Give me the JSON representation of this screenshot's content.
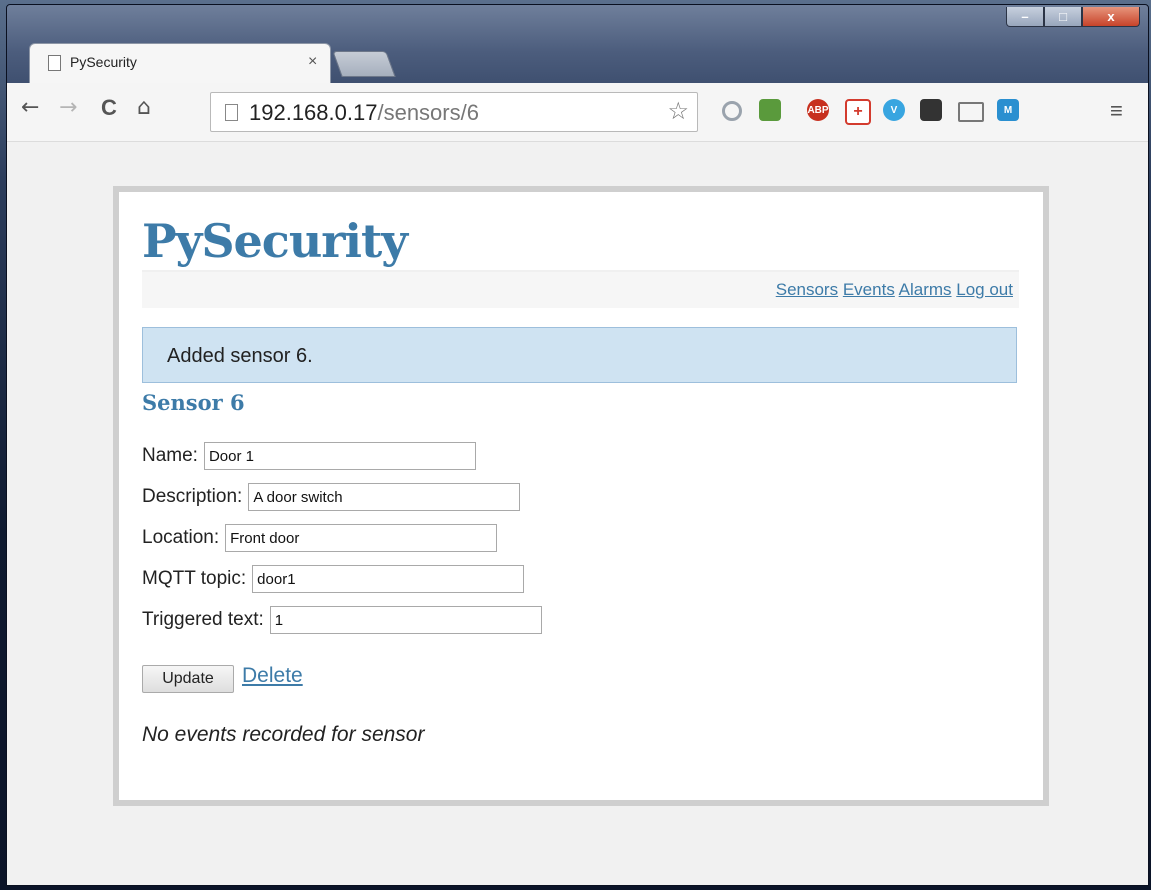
{
  "browser": {
    "tab_title": "PySecurity",
    "tab_close": "×",
    "url_host": "192.168.0.17",
    "url_path": "/sensors/6",
    "window_controls": {
      "minimize": "–",
      "maximize": "□",
      "close": "x"
    },
    "nav": {
      "back": "←",
      "forward": "→",
      "reload": "C",
      "home": "⌂"
    },
    "menu": "≡",
    "extensions": [
      {
        "name": "search-extension-icon",
        "label": "",
        "color": "#9aa3ad"
      },
      {
        "name": "evernote-extension-icon",
        "label": "",
        "color": "#5a9a3c"
      },
      {
        "name": "adblock-plus-icon",
        "label": "ABP",
        "color": "#c7301f"
      },
      {
        "name": "plus-extension-icon",
        "label": "+",
        "color": "#d33b2e"
      },
      {
        "name": "vimeo-extension-icon",
        "label": "V",
        "color": "#38a5e0"
      },
      {
        "name": "film-extension-icon",
        "label": "",
        "color": "#333333"
      },
      {
        "name": "cast-icon",
        "label": "",
        "color": "#777777"
      },
      {
        "name": "m-extension-icon",
        "label": "M",
        "color": "#2a8fd0"
      }
    ]
  },
  "site": {
    "title": "PySecurity",
    "nav": {
      "sensors": "Sensors",
      "events": "Events",
      "alarms": "Alarms",
      "logout": "Log out"
    },
    "flash": "Added sensor 6.",
    "heading": "Sensor 6"
  },
  "form": {
    "name_label": "Name:",
    "name_value": "Door 1",
    "description_label": "Description:",
    "description_value": "A door switch",
    "location_label": "Location:",
    "location_value": "Front door",
    "mqtt_label": "MQTT topic:",
    "mqtt_value": "door1",
    "triggered_label": "Triggered text:",
    "triggered_value": "1",
    "update_label": "Update",
    "delete_label": "Delete"
  },
  "events": {
    "empty_message": "No events recorded for sensor"
  },
  "colors": {
    "link": "#3d7ba8",
    "flash_bg": "#cfe3f2"
  }
}
